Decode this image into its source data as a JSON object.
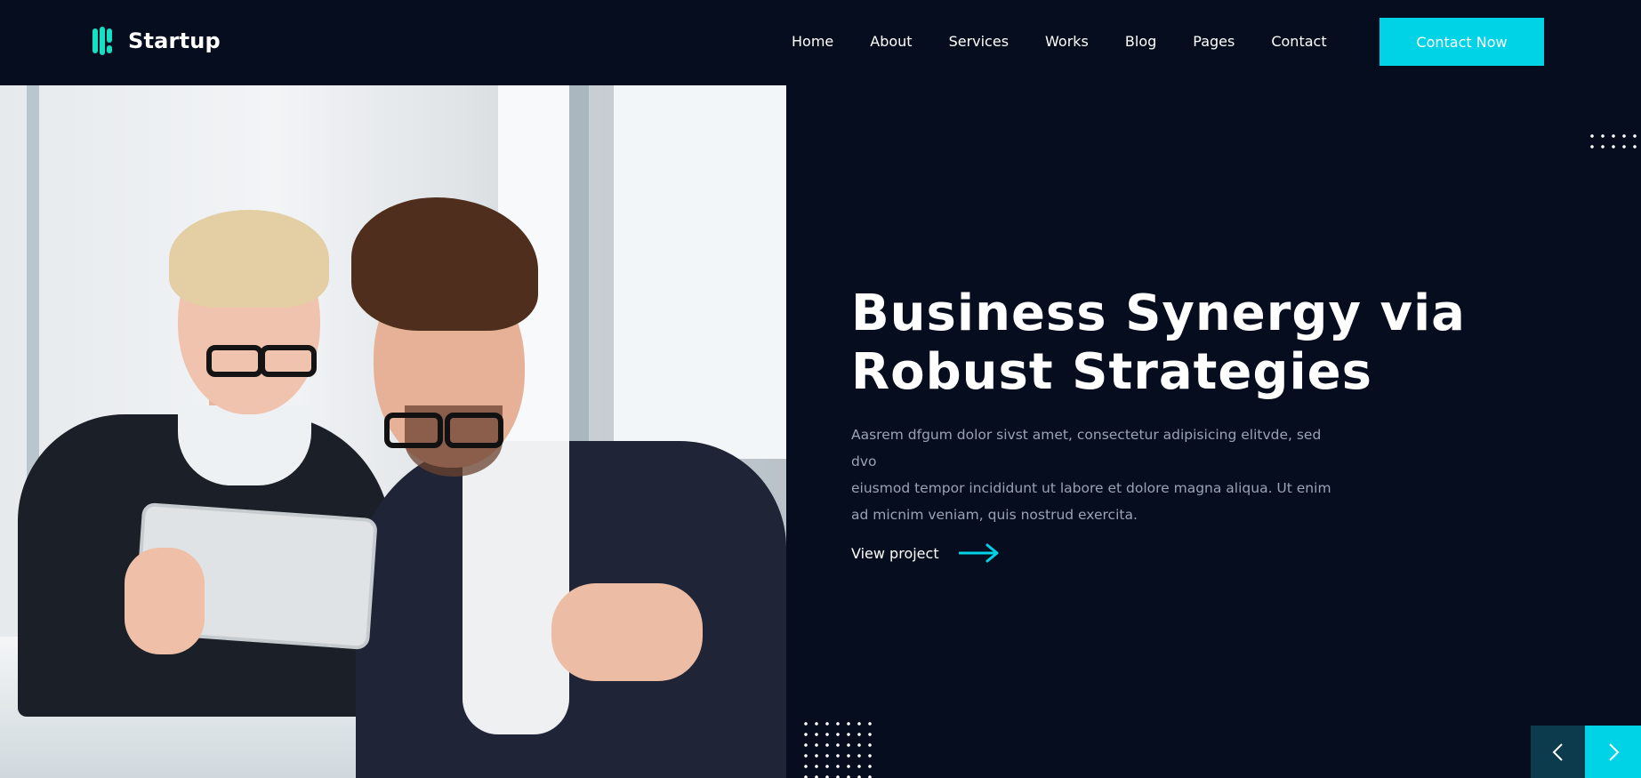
{
  "brand": {
    "name": "Startup",
    "accent_color": "#00d3e6",
    "logo_color": "#16e0c4",
    "background_color": "#050d1e"
  },
  "nav": {
    "items": [
      {
        "label": "Home"
      },
      {
        "label": "About"
      },
      {
        "label": "Services"
      },
      {
        "label": "Works"
      },
      {
        "label": "Blog"
      },
      {
        "label": "Pages"
      },
      {
        "label": "Contact"
      }
    ],
    "cta_label": "Contact Now"
  },
  "hero": {
    "title_line1": "Business Synergy via",
    "title_line2": "Robust Strategies",
    "description_line1": "Aasrem dfgum dolor sivst amet, consectetur adipisicing elitvde, sed dvo",
    "description_line2": "eiusmod tempor incididunt ut labore et dolore magna aliqua. Ut enim",
    "description_line3": "ad micnim veniam, quis nostrud exercita.",
    "link_label": "View project",
    "link_icon": "arrow-right-icon"
  },
  "slider": {
    "prev_icon": "chevron-left-icon",
    "next_icon": "chevron-right-icon"
  }
}
